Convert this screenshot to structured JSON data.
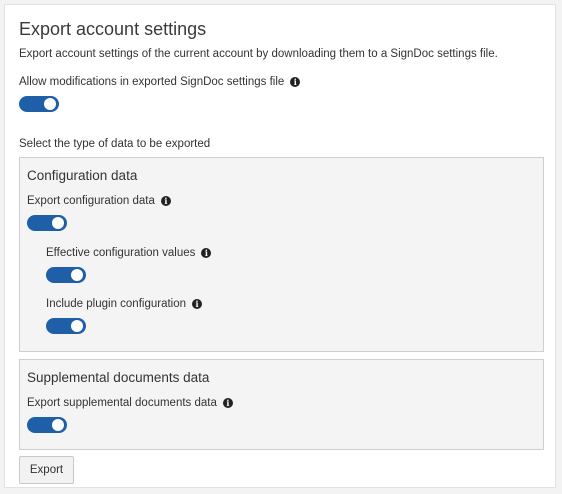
{
  "page": {
    "title": "Export account settings",
    "description": "Export account settings of the current account by downloading them to a SignDoc settings file."
  },
  "allow_modifications": {
    "label": "Allow modifications in exported SignDoc settings file",
    "enabled": true
  },
  "select_type_label": "Select the type of data to be exported",
  "configuration_group": {
    "title": "Configuration data",
    "export_configuration": {
      "label": "Export configuration data",
      "enabled": true
    },
    "effective_values": {
      "label": "Effective configuration values",
      "enabled": true
    },
    "plugin_configuration": {
      "label": "Include plugin configuration",
      "enabled": true
    }
  },
  "supplemental_group": {
    "title": "Supplemental documents data",
    "export_supplemental": {
      "label": "Export supplemental documents data",
      "enabled": true
    }
  },
  "export_button": {
    "label": "Export"
  },
  "colors": {
    "toggle_on": "#1f5fa8",
    "group_background": "#f4f4f4",
    "group_border": "#cfcfcf"
  }
}
